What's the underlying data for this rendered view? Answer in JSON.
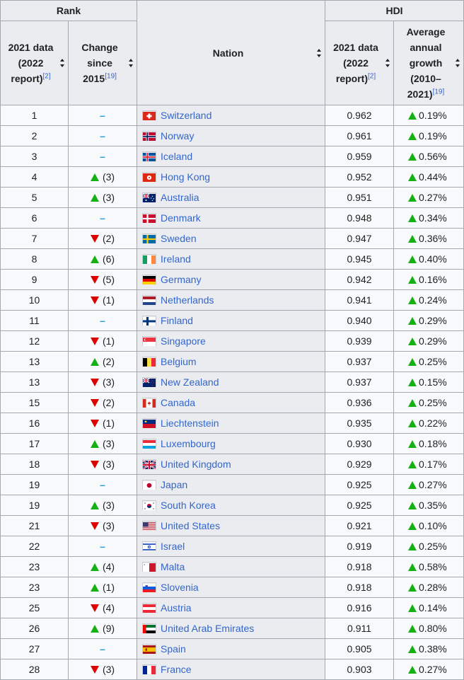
{
  "table": {
    "headers": {
      "rank_group": "Rank",
      "hdi_group": "HDI",
      "nation": "Nation",
      "rank_2021_line1": "2021 data",
      "rank_2021_line2": "(2022",
      "rank_2021_line3": "report)",
      "rank_2021_ref": "[2]",
      "change_line1": "Change",
      "change_line2": "since",
      "change_line3": "2015",
      "change_ref": "[19]",
      "hdi_2021_line1": "2021 data",
      "hdi_2021_line2": "(2022",
      "hdi_2021_line3": "report)",
      "hdi_2021_ref": "[2]",
      "growth_line1": "Average",
      "growth_line2": "annual",
      "growth_line3": "growth",
      "growth_line4": "(2010–",
      "growth_line5": "2021)",
      "growth_ref": "[19]"
    },
    "rows": [
      {
        "rank": "1",
        "change_dir": "none",
        "change": "",
        "nation": "Switzerland",
        "flag": "switzerland",
        "hdi": "0.962",
        "growth": "0.19%"
      },
      {
        "rank": "2",
        "change_dir": "none",
        "change": "",
        "nation": "Norway",
        "flag": "norway",
        "hdi": "0.961",
        "growth": "0.19%"
      },
      {
        "rank": "3",
        "change_dir": "none",
        "change": "",
        "nation": "Iceland",
        "flag": "iceland",
        "hdi": "0.959",
        "growth": "0.56%"
      },
      {
        "rank": "4",
        "change_dir": "up",
        "change": "(3)",
        "nation": "Hong Kong",
        "flag": "hongkong",
        "hdi": "0.952",
        "growth": "0.44%"
      },
      {
        "rank": "5",
        "change_dir": "up",
        "change": "(3)",
        "nation": "Australia",
        "flag": "australia",
        "hdi": "0.951",
        "growth": "0.27%"
      },
      {
        "rank": "6",
        "change_dir": "none",
        "change": "",
        "nation": "Denmark",
        "flag": "denmark",
        "hdi": "0.948",
        "growth": "0.34%"
      },
      {
        "rank": "7",
        "change_dir": "down",
        "change": "(2)",
        "nation": "Sweden",
        "flag": "sweden",
        "hdi": "0.947",
        "growth": "0.36%"
      },
      {
        "rank": "8",
        "change_dir": "up",
        "change": "(6)",
        "nation": "Ireland",
        "flag": "ireland",
        "hdi": "0.945",
        "growth": "0.40%"
      },
      {
        "rank": "9",
        "change_dir": "down",
        "change": "(5)",
        "nation": "Germany",
        "flag": "germany",
        "hdi": "0.942",
        "growth": "0.16%"
      },
      {
        "rank": "10",
        "change_dir": "down",
        "change": "(1)",
        "nation": "Netherlands",
        "flag": "netherlands",
        "hdi": "0.941",
        "growth": "0.24%"
      },
      {
        "rank": "11",
        "change_dir": "none",
        "change": "",
        "nation": "Finland",
        "flag": "finland",
        "hdi": "0.940",
        "growth": "0.29%"
      },
      {
        "rank": "12",
        "change_dir": "down",
        "change": "(1)",
        "nation": "Singapore",
        "flag": "singapore",
        "hdi": "0.939",
        "growth": "0.29%"
      },
      {
        "rank": "13",
        "change_dir": "up",
        "change": "(2)",
        "nation": "Belgium",
        "flag": "belgium",
        "hdi": "0.937",
        "growth": "0.25%"
      },
      {
        "rank": "13",
        "change_dir": "down",
        "change": "(3)",
        "nation": "New Zealand",
        "flag": "newzealand",
        "hdi": "0.937",
        "growth": "0.15%"
      },
      {
        "rank": "15",
        "change_dir": "down",
        "change": "(2)",
        "nation": "Canada",
        "flag": "canada",
        "hdi": "0.936",
        "growth": "0.25%"
      },
      {
        "rank": "16",
        "change_dir": "down",
        "change": "(1)",
        "nation": "Liechtenstein",
        "flag": "liechtenstein",
        "hdi": "0.935",
        "growth": "0.22%"
      },
      {
        "rank": "17",
        "change_dir": "up",
        "change": "(3)",
        "nation": "Luxembourg",
        "flag": "luxembourg",
        "hdi": "0.930",
        "growth": "0.18%"
      },
      {
        "rank": "18",
        "change_dir": "down",
        "change": "(3)",
        "nation": "United Kingdom",
        "flag": "uk",
        "hdi": "0.929",
        "growth": "0.17%"
      },
      {
        "rank": "19",
        "change_dir": "none",
        "change": "",
        "nation": "Japan",
        "flag": "japan",
        "hdi": "0.925",
        "growth": "0.27%"
      },
      {
        "rank": "19",
        "change_dir": "up",
        "change": "(3)",
        "nation": "South Korea",
        "flag": "southkorea",
        "hdi": "0.925",
        "growth": "0.35%"
      },
      {
        "rank": "21",
        "change_dir": "down",
        "change": "(3)",
        "nation": "United States",
        "flag": "us",
        "hdi": "0.921",
        "growth": "0.10%"
      },
      {
        "rank": "22",
        "change_dir": "none",
        "change": "",
        "nation": "Israel",
        "flag": "israel",
        "hdi": "0.919",
        "growth": "0.25%"
      },
      {
        "rank": "23",
        "change_dir": "up",
        "change": "(4)",
        "nation": "Malta",
        "flag": "malta",
        "hdi": "0.918",
        "growth": "0.58%"
      },
      {
        "rank": "23",
        "change_dir": "up",
        "change": "(1)",
        "nation": "Slovenia",
        "flag": "slovenia",
        "hdi": "0.918",
        "growth": "0.28%"
      },
      {
        "rank": "25",
        "change_dir": "down",
        "change": "(4)",
        "nation": "Austria",
        "flag": "austria",
        "hdi": "0.916",
        "growth": "0.14%"
      },
      {
        "rank": "26",
        "change_dir": "up",
        "change": "(9)",
        "nation": "United Arab Emirates",
        "flag": "uae",
        "hdi": "0.911",
        "growth": "0.80%"
      },
      {
        "rank": "27",
        "change_dir": "none",
        "change": "",
        "nation": "Spain",
        "flag": "spain",
        "hdi": "0.905",
        "growth": "0.38%"
      },
      {
        "rank": "28",
        "change_dir": "down",
        "change": "(3)",
        "nation": "France",
        "flag": "france",
        "hdi": "0.903",
        "growth": "0.27%"
      }
    ]
  },
  "colors": {
    "link": "#3366cc",
    "up": "#14b014",
    "down": "#dd0000",
    "no_change": "#1e9fe8",
    "header_bg": "#eaecf0",
    "cell_bg": "#f8f9fa",
    "border": "#a2a9b1"
  }
}
